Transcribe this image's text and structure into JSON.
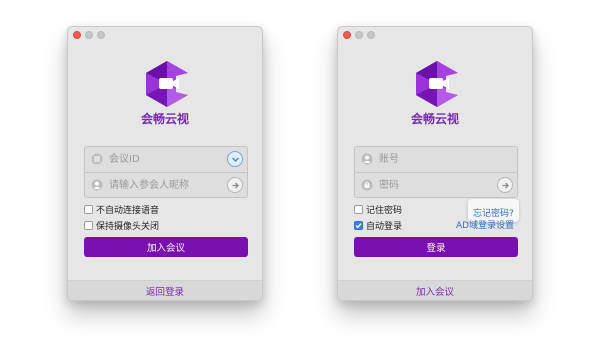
{
  "colors": {
    "brand": "#7a2ab0",
    "primary_button": "#7a0fb0",
    "link": "#2f6fc8",
    "checkbox_checked": "#3b82e6",
    "close_dot": "#f25b55"
  },
  "join_window": {
    "brand": "会畅云视",
    "meeting_id_placeholder": "会议ID",
    "nickname_placeholder": "请输入参会人昵称",
    "option_auto_connect_audio": "不自动连接语音",
    "option_keep_camera_off": "保持摄像头关闭",
    "join_button": "加入会议",
    "footer_link": "返回登录",
    "icons": {
      "meeting_id": "list-circle-icon",
      "nickname": "person-icon",
      "dropdown": "chevron-down-icon",
      "go": "arrow-right-icon"
    }
  },
  "login_window": {
    "brand": "会畅云视",
    "account_placeholder": "账号",
    "password_placeholder": "密码",
    "option_remember_password": "记住密码",
    "option_auto_login": "自动登录",
    "auto_login_checked": true,
    "forgot_password": "忘记密码?",
    "ad_domain_settings": "AD域登录设置",
    "login_button": "登录",
    "footer_link": "加入会议",
    "icons": {
      "account": "person-icon",
      "password": "lock-icon",
      "go": "arrow-right-icon"
    }
  }
}
